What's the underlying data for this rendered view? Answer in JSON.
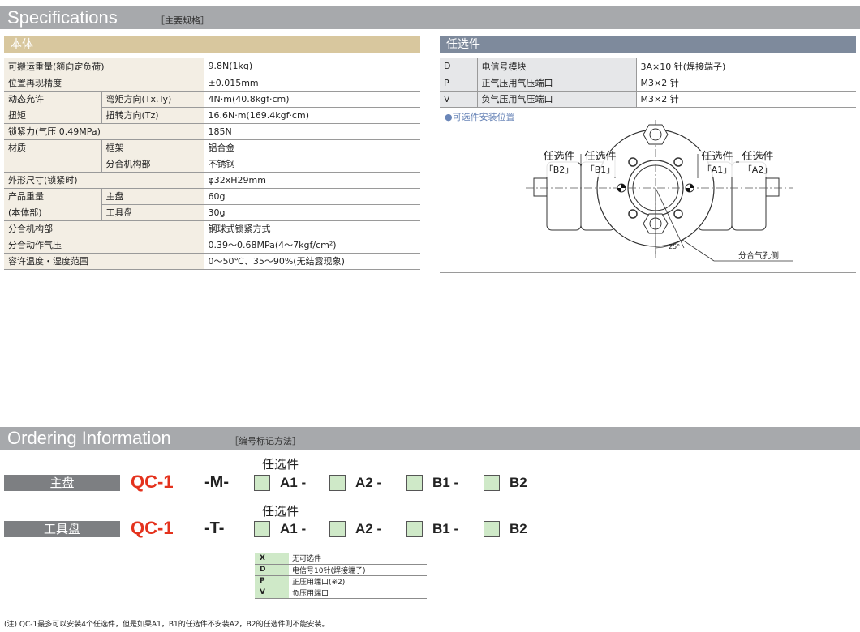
{
  "spec_band": {
    "title": "Specifications",
    "subtitle": "［主要规格］"
  },
  "body_section": {
    "title": "本体",
    "rows": [
      {
        "label": "可搬运重量(额向定负荷)",
        "sub": "",
        "value": "9.8N(1kg)"
      },
      {
        "label": "位置再现精度",
        "sub": "",
        "value": "±0.015mm"
      },
      {
        "label": "动态允许",
        "sub": "弯矩方向(Tx.Ty)",
        "value": "4N·m(40.8kgf·cm)"
      },
      {
        "label": "扭矩",
        "sub": "扭转方向(Tz)",
        "value": "16.6N·m(169.4kgf·cm)"
      },
      {
        "label": "锁紧力(气压 0.49MPa)",
        "sub": "",
        "value": "185N"
      },
      {
        "label": "材质",
        "sub": "框架",
        "value": "铝合金"
      },
      {
        "label": "",
        "sub": "分合机构部",
        "value": "不锈钢"
      },
      {
        "label": "外形尺寸(锁紧时)",
        "sub": "",
        "value": "φ32xH29mm"
      },
      {
        "label": "产品重量",
        "sub": "主盘",
        "value": "60g"
      },
      {
        "label": "(本体部)",
        "sub": "工具盘",
        "value": "30g"
      },
      {
        "label": "分合机构部",
        "sub": "",
        "value": "钢球式锁紧方式"
      },
      {
        "label": "分合动作气压",
        "sub": "",
        "value": "0.39～0.68MPa(4～7kgf/cm²)"
      },
      {
        "label": "容许温度・湿度范围",
        "sub": "",
        "value": "0～50℃、35～90%(无结露现象)"
      }
    ]
  },
  "options_section": {
    "title": "任选件",
    "rows": [
      {
        "code": "D",
        "name": "电信号模块",
        "value": "3A×10 针(焊接端子)"
      },
      {
        "code": "P",
        "name": "正气压用气压端口",
        "value": "M3×2 针"
      },
      {
        "code": "V",
        "name": "负气压用气压端口",
        "value": "M3×2 针"
      }
    ],
    "install_note": "●可选件安装位置",
    "diagram": {
      "labels": [
        "任选件「B2」",
        "任选件「B1」",
        "任选件「A1」",
        "任选件「A2」"
      ],
      "opt": "任选件",
      "b2": "「B2」",
      "b1": "「B1」",
      "a1": "「A1」",
      "a2": "「A2」",
      "angle": "25°",
      "air_side": "分合气孔侧"
    }
  },
  "order_band": {
    "title": "Ordering Information",
    "subtitle": "［编号标记方法］"
  },
  "ordering": {
    "option_label": "任选件",
    "rows": [
      {
        "name": "主盘",
        "model": "QC-1",
        "type": "-M-",
        "slots": [
          "A1 -",
          "A2 -",
          "B1 -",
          "B2"
        ]
      },
      {
        "name": "工具盘",
        "model": "QC-1",
        "type": "-T-",
        "slots": [
          "A1 -",
          "A2 -",
          "B1 -",
          "B2"
        ]
      }
    ],
    "legend": [
      {
        "code": "X",
        "desc": "无可选件"
      },
      {
        "code": "D",
        "desc": "电信号10针(焊接端子)"
      },
      {
        "code": "P",
        "desc": "正压用端口(※2)"
      },
      {
        "code": "V",
        "desc": "负压用端口"
      }
    ],
    "note": "(注) QC-1最多可以安装4个任选件，但是如果A1，B1的任选件不安装A2，B2的任选件则不能安装。"
  },
  "colors": {
    "accent_red": "#e4321d",
    "option_green": "#cfe9c8",
    "body_header": "#d8c79e",
    "option_header": "#7e8a9c"
  }
}
